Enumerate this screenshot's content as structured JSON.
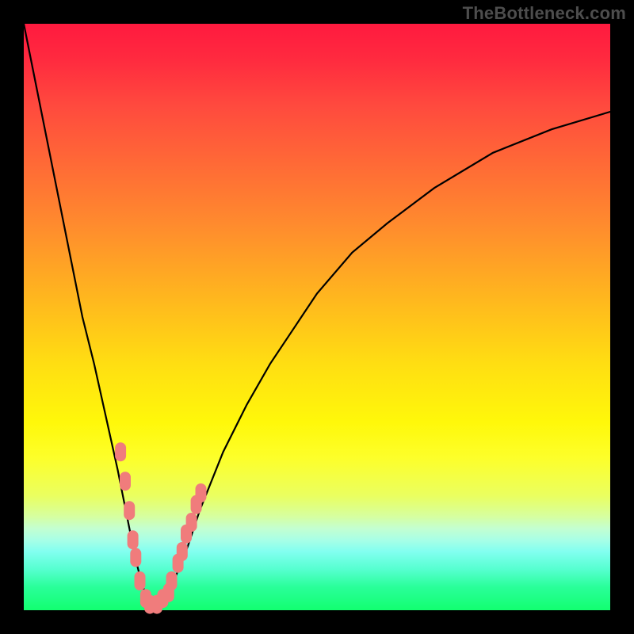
{
  "watermark": "TheBottleneck.com",
  "colors": {
    "frame": "#000000",
    "gradient_top": "#ff1a3f",
    "gradient_mid": "#ffde12",
    "gradient_bottom": "#12ff70",
    "curve": "#000000",
    "marker": "#f07c7c"
  },
  "chart_data": {
    "type": "line",
    "title": "",
    "xlabel": "",
    "ylabel": "",
    "xlim": [
      0,
      100
    ],
    "ylim": [
      0,
      100
    ],
    "grid": false,
    "series": [
      {
        "name": "bottleneck-curve",
        "x": [
          0,
          2,
          4,
          6,
          8,
          10,
          12,
          14,
          16,
          18,
          19,
          20,
          21,
          22,
          23,
          24,
          25,
          26,
          28,
          30,
          34,
          38,
          42,
          46,
          50,
          56,
          62,
          70,
          80,
          90,
          100
        ],
        "y": [
          100,
          90,
          80,
          70,
          60,
          50,
          42,
          33,
          24,
          14,
          9,
          5,
          2,
          1,
          1,
          2,
          4,
          6,
          11,
          17,
          27,
          35,
          42,
          48,
          54,
          61,
          66,
          72,
          78,
          82,
          85
        ]
      }
    ],
    "markers": {
      "name": "highlighted-points",
      "shape": "rounded-rect",
      "points": [
        {
          "x": 16.5,
          "y": 27
        },
        {
          "x": 17.3,
          "y": 22
        },
        {
          "x": 18.0,
          "y": 17
        },
        {
          "x": 18.6,
          "y": 12
        },
        {
          "x": 19.1,
          "y": 9
        },
        {
          "x": 19.8,
          "y": 5
        },
        {
          "x": 20.8,
          "y": 2
        },
        {
          "x": 21.5,
          "y": 1
        },
        {
          "x": 22.7,
          "y": 1
        },
        {
          "x": 23.7,
          "y": 2
        },
        {
          "x": 24.7,
          "y": 3
        },
        {
          "x": 25.2,
          "y": 5
        },
        {
          "x": 26.3,
          "y": 8
        },
        {
          "x": 27.0,
          "y": 10
        },
        {
          "x": 27.7,
          "y": 13
        },
        {
          "x": 28.6,
          "y": 15
        },
        {
          "x": 29.4,
          "y": 18
        },
        {
          "x": 30.2,
          "y": 20
        }
      ]
    }
  }
}
